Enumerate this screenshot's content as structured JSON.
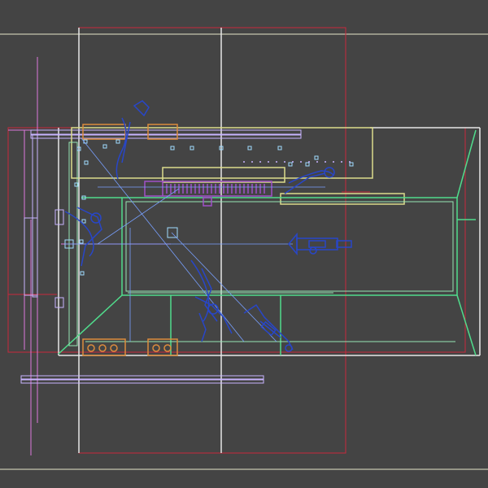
{
  "viewport": {
    "view": "top",
    "mode": "wireframe",
    "colors": {
      "background": "#444444",
      "boundary": "#e6e6c8",
      "red": "#c8283c",
      "pink": "#dc78dc",
      "magenta": "#a050c8",
      "lavender": "#c8b4ff",
      "green": "#50dc8c",
      "mint": "#96e6b4",
      "yellow": "#dcdc8c",
      "white": "#e6e6e6",
      "blue": "#2846c8",
      "lightblue": "#78a0ff",
      "orange": "#dc8c3c",
      "cyan": "#a0dcff"
    }
  }
}
